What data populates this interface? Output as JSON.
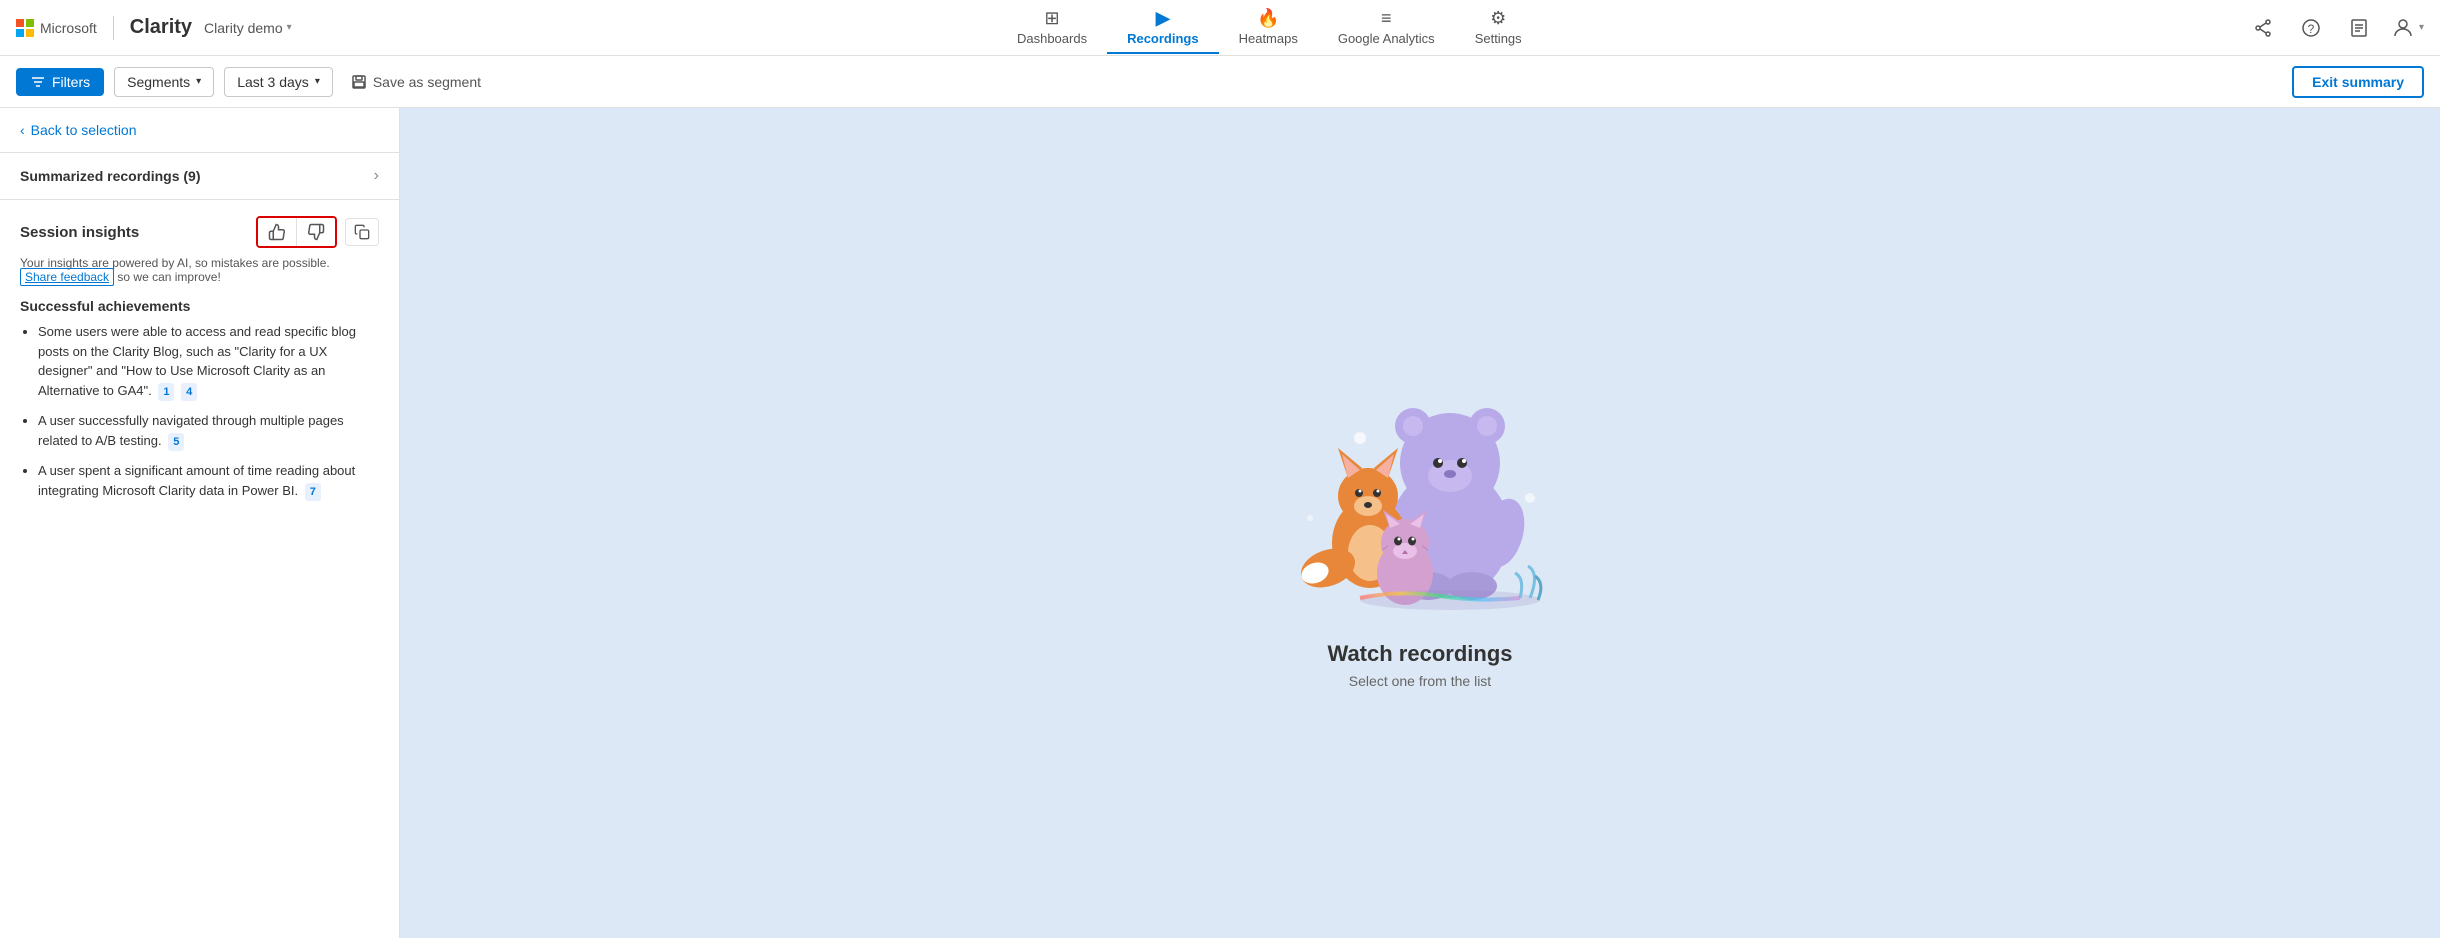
{
  "brand": {
    "ms_label": "Microsoft",
    "clarity_label": "Clarity"
  },
  "project": {
    "name": "Clarity demo",
    "chevron": "▾"
  },
  "nav": {
    "items": [
      {
        "id": "dashboards",
        "label": "Dashboards",
        "icon": "⊞",
        "active": false,
        "has_chevron": true
      },
      {
        "id": "recordings",
        "label": "Recordings",
        "icon": "🎥",
        "active": true,
        "has_chevron": false
      },
      {
        "id": "heatmaps",
        "label": "Heatmaps",
        "icon": "🔥",
        "active": false,
        "has_chevron": false
      },
      {
        "id": "google-analytics",
        "label": "Google Analytics",
        "icon": "≡",
        "active": false,
        "has_chevron": false
      },
      {
        "id": "settings",
        "label": "Settings",
        "icon": "⚙",
        "active": false,
        "has_chevron": false
      }
    ]
  },
  "toolbar": {
    "filters_label": "Filters",
    "segments_label": "Segments",
    "daterange_label": "Last 3 days",
    "save_segment_label": "Save as segment",
    "exit_summary_label": "Exit summary"
  },
  "left_panel": {
    "back_label": "Back to selection",
    "summarized_title": "Summarized recordings (9)",
    "insights_title": "Session insights",
    "ai_notice": "Your insights are powered by AI, so mistakes are possible.",
    "share_feedback_label": "Share feedback",
    "ai_notice_suffix": " so we can improve!",
    "achievements_title": "Successful achievements",
    "bullets": [
      {
        "text": "Some users were able to access and read specific blog posts on the Clarity Blog, such as \"Clarity for a UX designer\" and \"How to Use Microsoft Clarity as an Alternative to GA4\".",
        "tags": [
          "1",
          "4"
        ]
      },
      {
        "text": "A user successfully navigated through multiple pages related to A/B testing.",
        "tags": [
          "5"
        ]
      },
      {
        "text": "A user spent a significant amount of time reading about integrating Microsoft Clarity data in Power BI.",
        "tags": [
          "7"
        ]
      }
    ]
  },
  "right_panel": {
    "watch_title": "Watch recordings",
    "watch_subtitle": "Select one from the list"
  }
}
